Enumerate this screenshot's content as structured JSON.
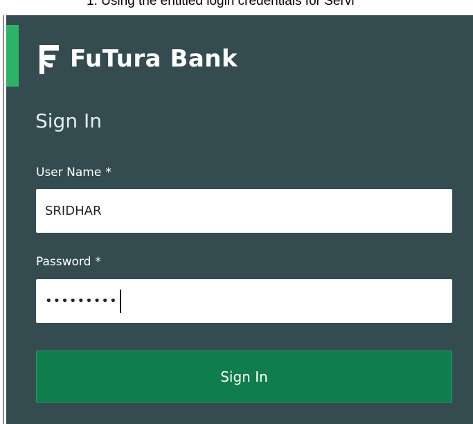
{
  "document_text": {
    "fragment": "1.   Using the entitled login credentials for Servi"
  },
  "brand": {
    "name": "FuTura Bank",
    "logo_icon": "futura-logo-icon"
  },
  "signin": {
    "heading": "Sign In",
    "username": {
      "label": "User Name",
      "required_marker": "*",
      "value": "SRIDHAR"
    },
    "password": {
      "label": "Password",
      "required_marker": "*",
      "masked_value": "•••••••••"
    },
    "submit_label": "Sign In"
  },
  "colors": {
    "panel_background": "#344c4f",
    "accent": "#2db368",
    "button": "#0f7d4c"
  }
}
